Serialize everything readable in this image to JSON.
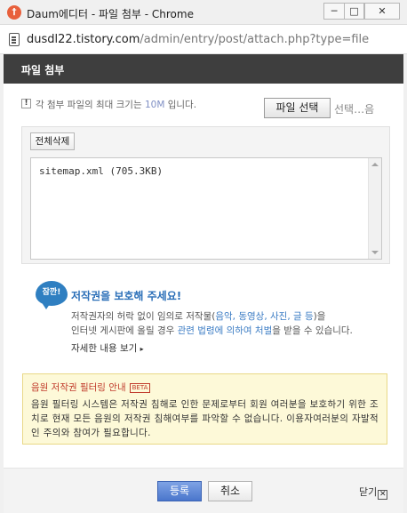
{
  "window": {
    "icon": "daum-logo-icon",
    "title": "Daum에디터 - 파일 첨부 - Chrome",
    "minimize": "─",
    "maximize": "□",
    "close": "✕"
  },
  "address": {
    "domain": "dusdl22.tistory.com",
    "path": "/admin/entry/post/attach.php?type=file"
  },
  "dialog": {
    "title": "파일 첨부"
  },
  "info": {
    "icon_char": "!",
    "text_before": "각 첨부 파일의 최대 크기는 ",
    "max_size": "10M",
    "text_after": " 입니다."
  },
  "file_select": {
    "button_label": "파일 선택",
    "status": "선택…음"
  },
  "file_panel": {
    "delete_all_label": "전체삭제",
    "files": [
      "sitemap.xml (705.3KB)"
    ]
  },
  "copyright": {
    "badge": "잠깐!",
    "title": "저작권을 보호해 주세요!",
    "line1_before": "저작권자의 허락 없이 임의로 저작물(",
    "line1_link": "음악, 동영상, 사진, 글 등",
    "line1_after": ")을",
    "line2_before": "인터넷 게시판에 올릴 경우 ",
    "line2_link": "관련 법령에 의하여 처벌",
    "line2_after": "을 받을 수 있습니다.",
    "more_label": "자세한 내용 보기",
    "more_arrow": "▸"
  },
  "music_filter": {
    "title": "음원 저작권 필터링 안내",
    "beta": "BETA",
    "body": "음원 필터링 시스템은 저작권 침해로 인한 문제로부터 회원 여러분을 보호하기 위한 조치로 현재 모든 음원의 저작권 침해여부를 파악할 수 없습니다. 이용자여러분의 자발적인 주의와 참여가 필요합니다."
  },
  "footer": {
    "register_label": "등록",
    "cancel_label": "취소",
    "close_label": "닫기",
    "close_icon_char": "✕"
  },
  "colors": {
    "header_bg": "#3e3e3e",
    "link_blue": "#3b7cc4",
    "notice_red": "#c03a2b",
    "notice_bg": "#fdf9d8",
    "primary_button": "#4a76cc"
  }
}
